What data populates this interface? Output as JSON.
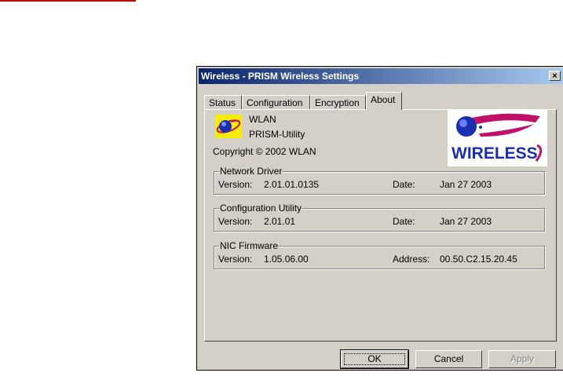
{
  "window": {
    "title": "Wireless - PRISM Wireless Settings",
    "close_glyph": "×"
  },
  "tabs": [
    {
      "label": "Status",
      "active": false
    },
    {
      "label": "Configuration",
      "active": false
    },
    {
      "label": "Encryption",
      "active": false
    },
    {
      "label": "About",
      "active": true
    }
  ],
  "about": {
    "product_line1": "WLAN",
    "product_line2": "PRISM-Utility",
    "copyright": "Copyright © 2002  WLAN",
    "logo_text": "WIRELESS",
    "version_label": "Version:",
    "date_label": "Date:",
    "address_label": "Address:",
    "groups": [
      {
        "title": "Network Driver",
        "version": "2.01.01.0135",
        "date": "Jan 27 2003"
      },
      {
        "title": "Configuration Utility",
        "version": "2.01.01",
        "date": "Jan 27 2003"
      },
      {
        "title": "NIC Firmware",
        "version": "1.05.06.00",
        "address": "00.50.C2.15.20.45"
      }
    ]
  },
  "buttons": {
    "ok": "OK",
    "cancel": "Cancel",
    "apply": "Apply"
  },
  "colors": {
    "accent_red": "#c00000",
    "logo_blue": "#1a2fb0",
    "logo_magenta": "#c0106a",
    "icon_yellow": "#f6ee00"
  }
}
